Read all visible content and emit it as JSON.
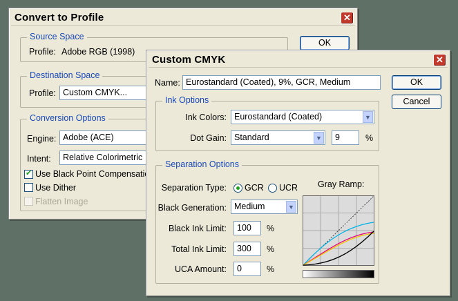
{
  "convert": {
    "title": "Convert to Profile",
    "ok_label": "OK",
    "source": {
      "heading": "Source Space",
      "profile_label": "Profile:",
      "profile_value": "Adobe RGB (1998)"
    },
    "destination": {
      "heading": "Destination Space",
      "profile_label": "Profile:",
      "profile_value": "Custom CMYK..."
    },
    "conversion": {
      "heading": "Conversion Options",
      "engine_label": "Engine:",
      "engine_value": "Adobe (ACE)",
      "intent_label": "Intent:",
      "intent_value": "Relative Colorimetric",
      "black_point_label": "Use Black Point Compensation",
      "dither_label": "Use Dither",
      "flatten_label": "Flatten Image"
    }
  },
  "cmyk": {
    "title": "Custom CMYK",
    "name_label": "Name:",
    "name_value": "Eurostandard (Coated), 9%, GCR, Medium",
    "ok_label": "OK",
    "cancel_label": "Cancel",
    "ink": {
      "heading": "Ink Options",
      "ink_colors_label": "Ink Colors:",
      "ink_colors_value": "Eurostandard (Coated)",
      "dot_gain_label": "Dot Gain:",
      "dot_gain_value": "Standard",
      "dot_gain_amount": "9",
      "percent": "%"
    },
    "separation": {
      "heading": "Separation Options",
      "type_label": "Separation Type:",
      "gcr_label": "GCR",
      "ucr_label": "UCR",
      "gray_ramp_label": "Gray Ramp:",
      "black_gen_label": "Black Generation:",
      "black_gen_value": "Medium",
      "black_ink_limit_label": "Black Ink Limit:",
      "black_ink_limit_value": "100",
      "total_ink_limit_label": "Total Ink Limit:",
      "total_ink_limit_value": "300",
      "uca_amount_label": "UCA Amount:",
      "uca_amount_value": "0",
      "percent": "%"
    }
  },
  "icons": {
    "close": "close-icon",
    "dropdown": "chevron-down-icon",
    "gcr_selected": true,
    "black_point_checked": true,
    "dither_checked": false,
    "flatten_disabled": true
  },
  "colors": {
    "background": "#5f7066",
    "dialog": "#ece9d8",
    "group_heading": "#1a4ab8",
    "close_button": "#c0392b",
    "ramp_cyan": "#00b4e6",
    "ramp_magenta": "#e6007a",
    "ramp_yellow": "#f0c800",
    "ramp_black": "#000000"
  }
}
